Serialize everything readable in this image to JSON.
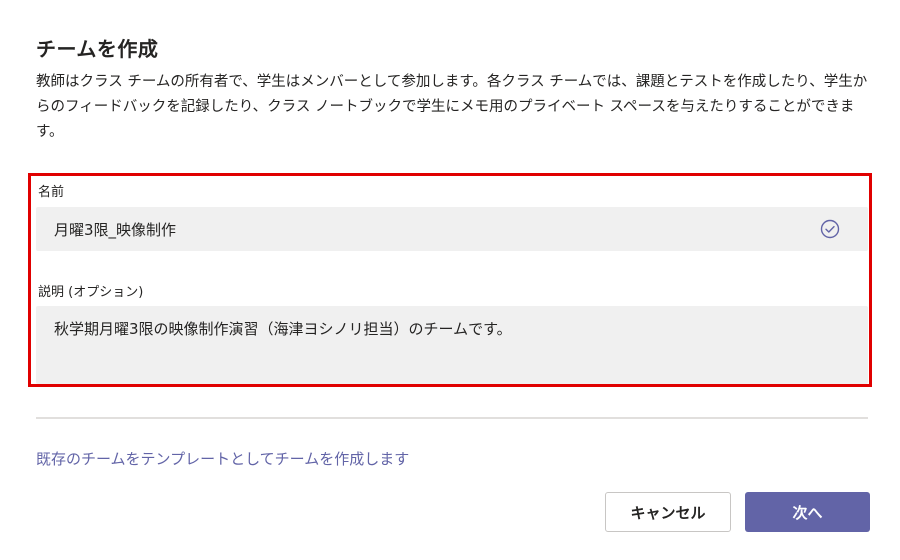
{
  "dialog": {
    "title": "チームを作成",
    "description": "教師はクラス チームの所有者で、学生はメンバーとして参加します。各クラス チームでは、課題とテストを作成したり、学生からのフィードバックを記録したり、クラス ノートブックで学生にメモ用のプライベート スペースを与えたりすることができます。"
  },
  "form": {
    "name_label": "名前",
    "name_value": "月曜3限_映像制作",
    "description_label": "説明 (オプション)",
    "description_value": "秋学期月曜3限の映像制作演習（海津ヨシノリ担当）のチームです。"
  },
  "template_link": "既存のチームをテンプレートとしてチームを作成します",
  "buttons": {
    "cancel": "キャンセル",
    "next": "次へ"
  },
  "colors": {
    "accent": "#6264a7",
    "highlight_border": "#e00000",
    "input_background": "#f0f0f0"
  },
  "icons": {
    "name_valid": "check-circle-icon"
  }
}
